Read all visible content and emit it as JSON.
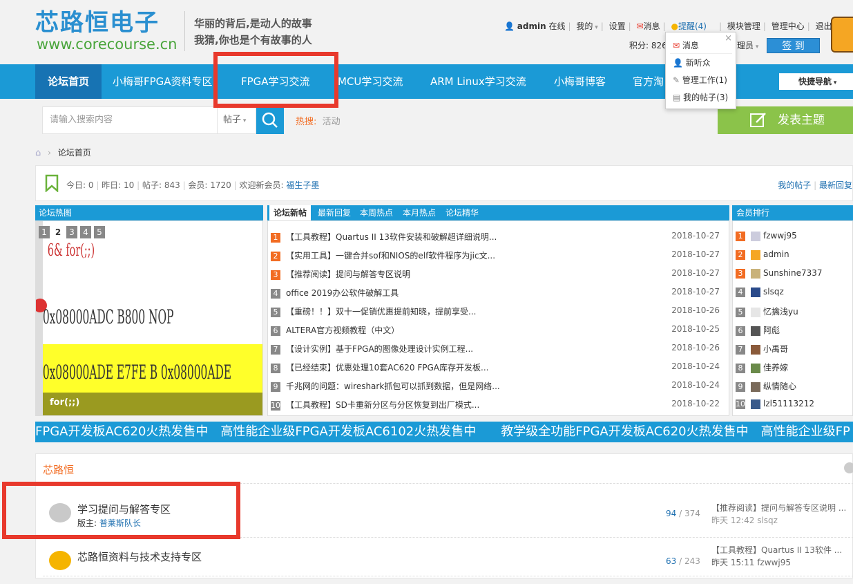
{
  "header": {
    "logo_cn": "芯路恒电子",
    "logo_en": "www.corecourse.cn",
    "slogan_line1": "华丽的背后,是动人的故事",
    "slogan_line2": "我猜,你也是个有故事的人",
    "user": {
      "name": "admin",
      "status": "在线",
      "my": "我的",
      "settings": "设置",
      "messages": "消息",
      "reminders": "提醒(4)",
      "module_manage": "模块管理",
      "admin_center": "管理中心",
      "logout": "退出",
      "points": "积分: 826",
      "role": "理员",
      "checkin": "签 到"
    }
  },
  "popup": {
    "items": [
      "消息",
      "新听众",
      "管理工作(1)",
      "我的帖子(3)"
    ],
    "close": "×"
  },
  "nav": {
    "items": [
      "论坛首页",
      "小梅哥FPGA资料专区",
      "FPGA学习交流",
      "MCU学习交流",
      "ARM Linux学习交流",
      "小梅哥博客",
      "官方淘"
    ],
    "quicknav": "快捷导航"
  },
  "search": {
    "placeholder": "请输入搜索内容",
    "type": "帖子",
    "hot_label": "热搜:",
    "hot_item": "活动",
    "post_button": "发表主题"
  },
  "breadcrumb": "论坛首页",
  "stats": {
    "today": "今日: 0",
    "yesterday": "昨日: 10",
    "posts": "帖子: 843",
    "members": "会员: 1720",
    "welcome": "欢迎新会员:",
    "newest": "福生子墨",
    "my_posts": "我的帖子",
    "latest_reply": "最新回复"
  },
  "hot_image": {
    "title": "论坛热图",
    "pages": [
      "1",
      "2",
      "3",
      "4",
      "5"
    ],
    "caption": "for(;;)"
  },
  "new_posts": {
    "tabs": [
      "论坛新帖",
      "最新回复",
      "本周热点",
      "本月热点",
      "论坛精华"
    ],
    "rows": [
      {
        "n": "1",
        "title": "【工具教程】Quartus II 13软件安装和破解超详细说明...",
        "date": "2018-10-27"
      },
      {
        "n": "2",
        "title": "【实用工具】一键合并sof和NIOS的elf软件程序为jic文...",
        "date": "2018-10-27"
      },
      {
        "n": "3",
        "title": "【推荐阅读】提问与解答专区说明",
        "date": "2018-10-27"
      },
      {
        "n": "4",
        "title": "office 2019办公软件破解工具",
        "date": "2018-10-27"
      },
      {
        "n": "5",
        "title": "【重磅！！】双十一促销优惠提前知晓，提前享受...",
        "date": "2018-10-26"
      },
      {
        "n": "6",
        "title": "ALTERA官方视频教程（中文）",
        "date": "2018-10-25"
      },
      {
        "n": "7",
        "title": "【设计实例】基于FPGA的图像处理设计实例工程...",
        "date": "2018-10-26"
      },
      {
        "n": "8",
        "title": "【已经结束】优惠处理10套AC620 FPGA库存开发板...",
        "date": "2018-10-24"
      },
      {
        "n": "9",
        "title": "千兆网的问题：wireshark抓包可以抓到数据，但是网络...",
        "date": "2018-10-24"
      },
      {
        "n": "10",
        "title": "【工具教程】SD卡重新分区与分区恢复到出厂模式...",
        "date": "2018-10-22"
      }
    ]
  },
  "ranking": {
    "title": "会员排行",
    "rows": [
      {
        "n": "1",
        "name": "fzwwj95"
      },
      {
        "n": "2",
        "name": "admin"
      },
      {
        "n": "3",
        "name": "Sunshine7337"
      },
      {
        "n": "4",
        "name": "slsqz"
      },
      {
        "n": "5",
        "name": "忆擒浅yu"
      },
      {
        "n": "6",
        "name": "阿彪"
      },
      {
        "n": "7",
        "name": "小禹哥"
      },
      {
        "n": "8",
        "name": "佳养嫁"
      },
      {
        "n": "9",
        "name": "纵情随心"
      },
      {
        "n": "10",
        "name": "lzl51113212"
      }
    ]
  },
  "ticker": "FPGA开发板AC620火热发售中　高性能企业级FPGA开发板AC6102火热发售中　　教学级全功能FPGA开发板AC620火热发售中　高性能企业级FP",
  "forum": {
    "section": "芯路恒",
    "rows": [
      {
        "name": "学习提问与解答专区",
        "mod_label": "版主:",
        "mod": "普莱斯队长",
        "today": "94",
        "total": "/ 374",
        "last_title": "【推荐阅读】提问与解答专区说明 ...",
        "last_time": "昨天 12:42 slsqz"
      },
      {
        "name": "芯路恒资料与技术支持专区",
        "mod_label": "",
        "mod": "",
        "today": "63",
        "total": "/ 243",
        "last_title": "【工具教程】Quartus II 13软件 ...",
        "last_time": "昨天 15:11 fzwwj95"
      }
    ]
  },
  "colors": {
    "nav_blue": "#1b9ad6",
    "accent_orange": "#f26c22",
    "post_green": "#8bc34a",
    "highlight_red": "#e8392c"
  }
}
